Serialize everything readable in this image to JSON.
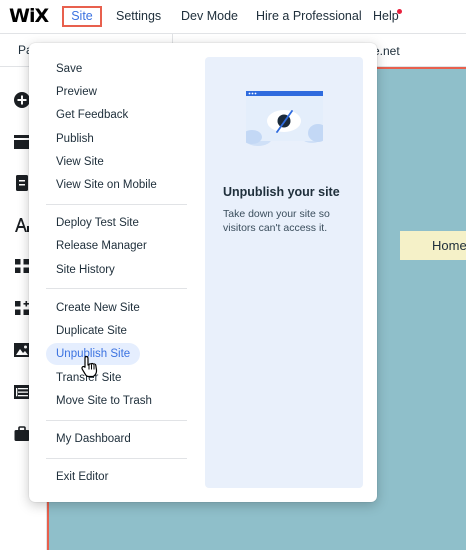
{
  "topbar": {
    "logo": "WiX",
    "tabs": {
      "site": "Site",
      "settings": "Settings",
      "dev_mode": "Dev Mode",
      "hire": "Hire a Professional",
      "help": "Help"
    },
    "help_notification_color": "#e8213d"
  },
  "secondbar": {
    "page_label": "Pa",
    "url_fragment": "e.net"
  },
  "sidebar": {
    "icons": [
      "add-icon",
      "sections-icon",
      "pages-icon",
      "text-theme-icon",
      "apps-icon",
      "apps-market-icon",
      "media-icon",
      "cms-table-icon",
      "business-briefcase-icon"
    ]
  },
  "canvas": {
    "background": "#8fbfca",
    "nav_home": "Home"
  },
  "dropdown": {
    "groups": [
      [
        "Save",
        "Preview",
        "Get Feedback",
        "Publish",
        "View Site",
        "View Site on Mobile"
      ],
      [
        "Deploy Test Site",
        "Release Manager",
        "Site History"
      ],
      [
        "Create New Site",
        "Duplicate Site",
        "Unpublish Site",
        "Transfer Site",
        "Move Site to Trash"
      ],
      [
        "My Dashboard"
      ],
      [
        "Exit Editor"
      ]
    ],
    "active_item": "Unpublish Site",
    "info": {
      "title": "Unpublish your site",
      "description": "Take down your site so visitors can't access it."
    }
  },
  "colors": {
    "accent": "#3b72e0",
    "highlight_border": "#e8604d",
    "info_panel": "#e9f0fb"
  }
}
